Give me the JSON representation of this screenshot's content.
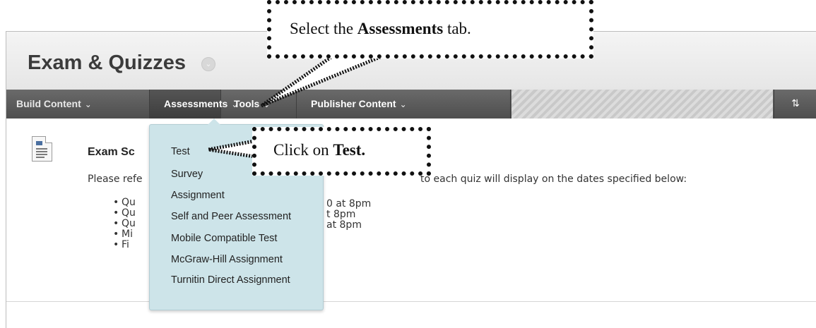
{
  "header": {
    "title": "Exam & Quizzes",
    "title_menu_icon": "chevron-down-icon"
  },
  "navbar": {
    "tabs": [
      {
        "label": "Build Content",
        "chevron": "⌄"
      },
      {
        "label": "Assessments",
        "chevron": "⌄"
      },
      {
        "label": "Tools",
        "chevron": "⌄"
      },
      {
        "label": "Publisher Content",
        "chevron": "⌄"
      }
    ],
    "sort_icon": "⇅"
  },
  "dropdown": {
    "items": [
      "Test",
      "Survey",
      "Assignment",
      "Self and Peer Assessment",
      "Mobile Compatible Test",
      "McGraw-Hill Assignment",
      "Turnitin Direct Assignment"
    ]
  },
  "content_item": {
    "title": "Exam Sc",
    "desc_start": "Please refe",
    "desc_end": "to each quiz will display on the dates specified below:",
    "bullets_left": [
      "Qu",
      "Qu",
      "Qu",
      "Mi",
      "Fi"
    ],
    "bullets_right": [
      "0 at 8pm",
      "t 8pm",
      "at 8pm"
    ]
  },
  "callouts": {
    "assessments": {
      "prefix": "Select the ",
      "bold": "Assessments",
      "suffix": " tab."
    },
    "test": {
      "prefix": "Click on ",
      "bold": "Test."
    }
  }
}
